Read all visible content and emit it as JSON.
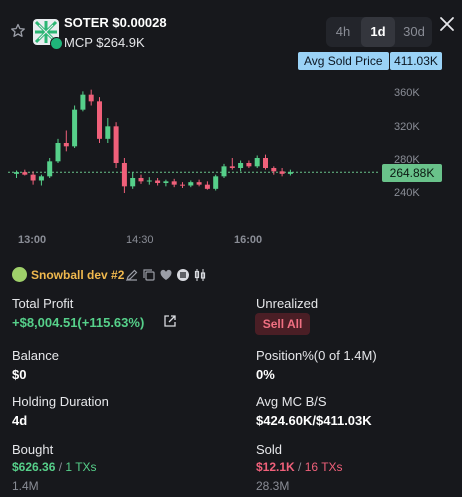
{
  "header": {
    "title": "SOTER $0.00028",
    "mcp": "MCP $264.9K"
  },
  "timeframes": [
    {
      "label": "4h",
      "active": false
    },
    {
      "label": "1d",
      "active": true
    },
    {
      "label": "30d",
      "active": false
    }
  ],
  "chart": {
    "avg_sold_label": "Avg Sold Price",
    "avg_sold_value": "411.03K",
    "y_ticks": [
      "360K",
      "320K",
      "280K",
      "240K"
    ],
    "current_price_label": "264.88K",
    "x_ticks": [
      "13:00",
      "14:30",
      "16:00"
    ]
  },
  "chart_data": {
    "type": "candlestick",
    "y_range": [
      230000,
      370000
    ],
    "current_price": 264880,
    "up_color": "#56d08a",
    "down_color": "#f0607a",
    "candles": [
      {
        "o": 263000,
        "h": 267000,
        "l": 258000,
        "c": 265000
      },
      {
        "o": 265000,
        "h": 268000,
        "l": 261000,
        "c": 262000
      },
      {
        "o": 262000,
        "h": 266000,
        "l": 250000,
        "c": 255000
      },
      {
        "o": 255000,
        "h": 262000,
        "l": 249000,
        "c": 260000
      },
      {
        "o": 260000,
        "h": 282000,
        "l": 258000,
        "c": 278000
      },
      {
        "o": 278000,
        "h": 305000,
        "l": 276000,
        "c": 300000
      },
      {
        "o": 300000,
        "h": 315000,
        "l": 290000,
        "c": 296000
      },
      {
        "o": 296000,
        "h": 345000,
        "l": 294000,
        "c": 340000
      },
      {
        "o": 340000,
        "h": 362000,
        "l": 338000,
        "c": 358000
      },
      {
        "o": 358000,
        "h": 364000,
        "l": 345000,
        "c": 350000
      },
      {
        "o": 350000,
        "h": 355000,
        "l": 300000,
        "c": 305000
      },
      {
        "o": 305000,
        "h": 330000,
        "l": 300000,
        "c": 320000
      },
      {
        "o": 320000,
        "h": 325000,
        "l": 270000,
        "c": 276000
      },
      {
        "o": 276000,
        "h": 282000,
        "l": 240000,
        "c": 248000
      },
      {
        "o": 248000,
        "h": 265000,
        "l": 245000,
        "c": 258000
      },
      {
        "o": 258000,
        "h": 262000,
        "l": 251000,
        "c": 254000
      },
      {
        "o": 254000,
        "h": 259000,
        "l": 250000,
        "c": 255000
      },
      {
        "o": 255000,
        "h": 258000,
        "l": 249000,
        "c": 252000
      },
      {
        "o": 252000,
        "h": 256000,
        "l": 248000,
        "c": 254000
      },
      {
        "o": 254000,
        "h": 257000,
        "l": 247000,
        "c": 250000
      },
      {
        "o": 250000,
        "h": 253000,
        "l": 246000,
        "c": 249000
      },
      {
        "o": 249000,
        "h": 255000,
        "l": 247000,
        "c": 253000
      },
      {
        "o": 253000,
        "h": 256000,
        "l": 248000,
        "c": 250000
      },
      {
        "o": 250000,
        "h": 254000,
        "l": 244000,
        "c": 245000
      },
      {
        "o": 245000,
        "h": 262000,
        "l": 243000,
        "c": 260000
      },
      {
        "o": 260000,
        "h": 275000,
        "l": 258000,
        "c": 272000
      },
      {
        "o": 272000,
        "h": 282000,
        "l": 268000,
        "c": 270000
      },
      {
        "o": 270000,
        "h": 279000,
        "l": 266000,
        "c": 276000
      },
      {
        "o": 276000,
        "h": 279000,
        "l": 270000,
        "c": 272000
      },
      {
        "o": 272000,
        "h": 285000,
        "l": 270000,
        "c": 282000
      },
      {
        "o": 282000,
        "h": 286000,
        "l": 268000,
        "c": 270000
      },
      {
        "o": 270000,
        "h": 272000,
        "l": 262000,
        "c": 266000
      },
      {
        "o": 266000,
        "h": 270000,
        "l": 260000,
        "c": 263000
      },
      {
        "o": 263000,
        "h": 268000,
        "l": 261000,
        "c": 265000
      }
    ]
  },
  "dev": {
    "name": "Snowball dev #2"
  },
  "stats": {
    "total_profit_label": "Total Profit",
    "total_profit_value": "+$8,004.51(+115.63%)",
    "unrealized_label": "Unrealized",
    "sell_all_label": "Sell All",
    "balance_label": "Balance",
    "balance_value": "$0",
    "position_label": "Position%(0 of 1.4M)",
    "position_value": "0%",
    "holding_label": "Holding Duration",
    "holding_value": "4d",
    "avg_mc_label": "Avg MC B/S",
    "avg_mc_value": "$424.60K/$411.03K",
    "bought_label": "Bought",
    "bought_amount": "$626.36",
    "bought_txs": "1 TXs",
    "bought_tokens": "1.4M",
    "sold_label": "Sold",
    "sold_amount": "$12.1K",
    "sold_txs": "16 TXs",
    "sold_tokens": "28.3M",
    "separator": "/"
  }
}
